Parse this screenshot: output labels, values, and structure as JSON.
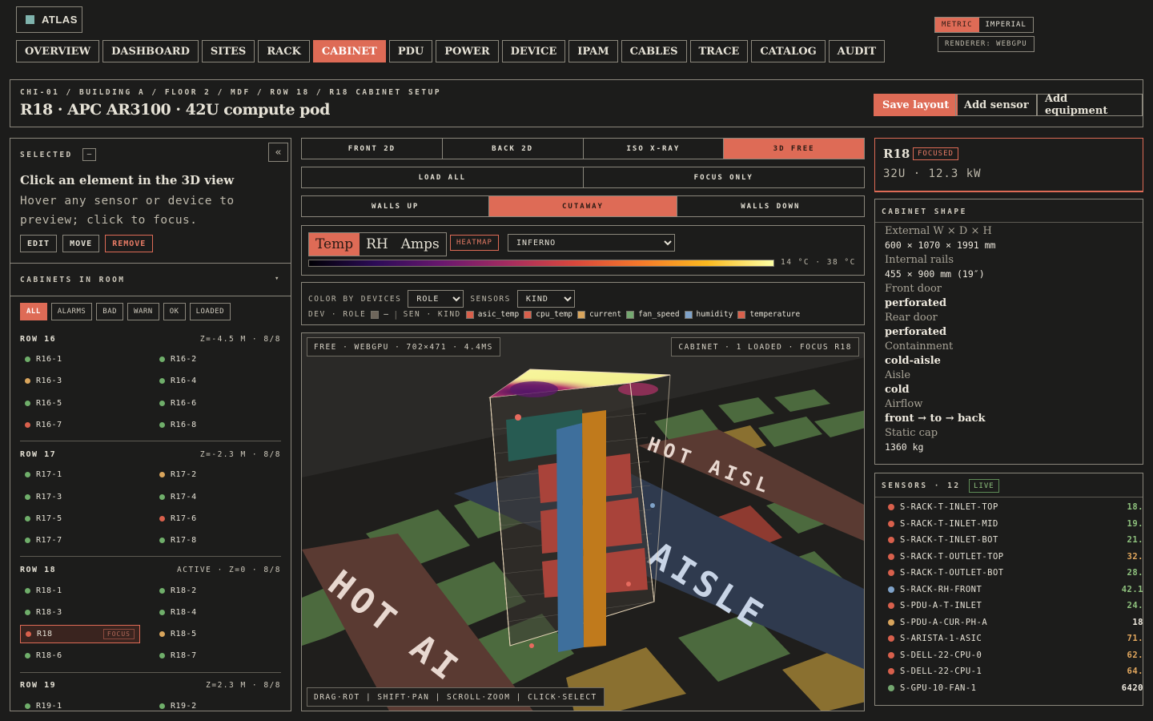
{
  "app": {
    "name": "ATLAS",
    "logo_color": "#7fb3ad"
  },
  "nav": [
    {
      "label": "OVERVIEW",
      "active": false
    },
    {
      "label": "DASHBOARD",
      "active": false
    },
    {
      "label": "SITES",
      "active": false
    },
    {
      "label": "RACK",
      "active": false
    },
    {
      "label": "CABINET",
      "active": true
    },
    {
      "label": "PDU",
      "active": false
    },
    {
      "label": "POWER",
      "active": false
    },
    {
      "label": "DEVICE",
      "active": false
    },
    {
      "label": "IPAM",
      "active": false
    },
    {
      "label": "CABLES",
      "active": false
    },
    {
      "label": "TRACE",
      "active": false
    },
    {
      "label": "CATALOG",
      "active": false
    },
    {
      "label": "AUDIT",
      "active": false
    }
  ],
  "units": {
    "metric": "METRIC",
    "imperial": "IMPERIAL",
    "selected": "METRIC"
  },
  "renderer": "RENDERER: WEBGPU",
  "header": {
    "breadcrumb": "CHI-01 / BUILDING A / FLOOR 2 / MDF / ROW 18 / R18 CABINET SETUP",
    "title": "R18 · APC AR3100 · 42U compute pod",
    "save": "Save layout",
    "add_sensor": "Add sensor",
    "add_equipment": "Add equipment"
  },
  "selected": {
    "label": "SELECTED",
    "badge": "—",
    "collapse": "«",
    "heading": "Click an element in the 3D view",
    "hint": "Hover any sensor or device to preview; click to focus.",
    "edit": "EDIT",
    "move": "MOVE",
    "remove": "REMOVE"
  },
  "cabinets": {
    "label": "CABINETS IN ROOM",
    "chevron": "▾",
    "filters": [
      "ALL",
      "ALARMS",
      "BAD",
      "WARN",
      "OK",
      "LOADED"
    ],
    "active_filter": "ALL",
    "rows": [
      {
        "name": "ROW 16",
        "meta": "Z=-4.5 M · 8/8",
        "items": [
          {
            "id": "R16-1",
            "status": "ok"
          },
          {
            "id": "R16-2",
            "status": "ok"
          },
          {
            "id": "R16-3",
            "status": "warn"
          },
          {
            "id": "R16-4",
            "status": "ok"
          },
          {
            "id": "R16-5",
            "status": "ok"
          },
          {
            "id": "R16-6",
            "status": "ok"
          },
          {
            "id": "R16-7",
            "status": "bad"
          },
          {
            "id": "R16-8",
            "status": "ok"
          }
        ]
      },
      {
        "name": "ROW 17",
        "meta": "Z=-2.3 M · 8/8",
        "items": [
          {
            "id": "R17-1",
            "status": "ok"
          },
          {
            "id": "R17-2",
            "status": "warn"
          },
          {
            "id": "R17-3",
            "status": "ok"
          },
          {
            "id": "R17-4",
            "status": "ok"
          },
          {
            "id": "R17-5",
            "status": "ok"
          },
          {
            "id": "R17-6",
            "status": "bad"
          },
          {
            "id": "R17-7",
            "status": "ok"
          },
          {
            "id": "R17-8",
            "status": "ok"
          }
        ]
      },
      {
        "name": "ROW 18",
        "meta": "ACTIVE · Z=0 · 8/8",
        "items": [
          {
            "id": "R18-1",
            "status": "ok"
          },
          {
            "id": "R18-2",
            "status": "ok"
          },
          {
            "id": "R18-3",
            "status": "ok"
          },
          {
            "id": "R18-4",
            "status": "ok"
          },
          {
            "id": "R18",
            "status": "bad",
            "focus": "FOCUS"
          },
          {
            "id": "R18-5",
            "status": "warn"
          },
          {
            "id": "R18-6",
            "status": "ok"
          },
          {
            "id": "R18-7",
            "status": "ok"
          }
        ]
      },
      {
        "name": "ROW 19",
        "meta": "Z=2.3 M · 8/8",
        "items": [
          {
            "id": "R19-1",
            "status": "ok"
          },
          {
            "id": "R19-2",
            "status": "ok"
          }
        ]
      }
    ]
  },
  "views": {
    "options": [
      "FRONT 2D",
      "BACK 2D",
      "ISO X-RAY",
      "3D FREE"
    ],
    "active": "3D FREE"
  },
  "load": {
    "options": [
      "LOAD ALL",
      "FOCUS ONLY"
    ]
  },
  "walls": {
    "options": [
      "WALLS UP",
      "CUTAWAY",
      "WALLS DOWN"
    ],
    "active": "CUTAWAY"
  },
  "metric": {
    "options": [
      "Temp",
      "RH",
      "Amps"
    ],
    "active": "Temp",
    "heatmap": "HEATMAP",
    "palette": "INFERNO",
    "range": "14 °C · 38 °C"
  },
  "colorby": {
    "label": "COLOR BY",
    "devices": "DEVICES",
    "role": "ROLE",
    "sensors": "SENSORS",
    "kind": "KIND",
    "dev_label": "DEV · ROLE",
    "dev_dash": "—",
    "sen_label": "SEN · KIND",
    "kinds": [
      {
        "name": "asic_temp",
        "color": "#d8604c"
      },
      {
        "name": "cpu_temp",
        "color": "#d8604c"
      },
      {
        "name": "current",
        "color": "#d9a55c"
      },
      {
        "name": "fan_speed",
        "color": "#74a870"
      },
      {
        "name": "humidity",
        "color": "#7fa2c8"
      },
      {
        "name": "temperature",
        "color": "#d8604c"
      }
    ]
  },
  "viewport": {
    "status": "FREE · WEBGPU · 702×471 · 4.4MS",
    "scope": "CABINET · 1 LOADED · FOCUS R18",
    "controls": "DRAG·ROT | SHIFT·PAN | SCROLL·ZOOM | CLICK·SELECT",
    "hot_aisle": "HOT AISLE",
    "cold_aisle": "COLD AISLE"
  },
  "focus": {
    "id": "R18",
    "badge": "FOCUSED",
    "summary": "32U · 12.3 kW"
  },
  "shape": {
    "label": "CABINET SHAPE",
    "rows": [
      {
        "k": "External W × D × H",
        "v": "600 × 1070 × 1991 mm",
        "mono": true
      },
      {
        "k": "Internal rails",
        "v": "455 × 900 mm (19″)",
        "mono": true
      },
      {
        "k": "Front door",
        "v": "perforated",
        "mono": false
      },
      {
        "k": "Rear door",
        "v": "perforated",
        "mono": false
      },
      {
        "k": "Containment",
        "v": "cold-aisle",
        "mono": false
      },
      {
        "k": "Aisle",
        "v": "cold",
        "mono": false
      },
      {
        "k": "Airflow",
        "v": "front → to → back",
        "mono": false
      },
      {
        "k": "Static cap",
        "v": "1360 kg",
        "mono": true
      }
    ]
  },
  "sensors": {
    "label": "SENSORS · 12",
    "live": "LIVE",
    "items": [
      {
        "name": "S-RACK-T-INLET-TOP",
        "value": "18.",
        "color": "#d8604c",
        "vcolor": "#8fc27e"
      },
      {
        "name": "S-RACK-T-INLET-MID",
        "value": "19.",
        "color": "#d8604c",
        "vcolor": "#8fc27e"
      },
      {
        "name": "S-RACK-T-INLET-BOT",
        "value": "21.",
        "color": "#d8604c",
        "vcolor": "#8fc27e"
      },
      {
        "name": "S-RACK-T-OUTLET-TOP",
        "value": "32.",
        "color": "#d8604c",
        "vcolor": "#e3a85e"
      },
      {
        "name": "S-RACK-T-OUTLET-BOT",
        "value": "28.",
        "color": "#d8604c",
        "vcolor": "#8fc27e"
      },
      {
        "name": "S-RACK-RH-FRONT",
        "value": "42.1",
        "color": "#7fa2c8",
        "vcolor": "#8fc27e"
      },
      {
        "name": "S-PDU-A-T-INLET",
        "value": "24.",
        "color": "#d8604c",
        "vcolor": "#8fc27e"
      },
      {
        "name": "S-PDU-A-CUR-PH-A",
        "value": "18",
        "color": "#d9a55c",
        "vcolor": "#efeadf"
      },
      {
        "name": "S-ARISTA-1-ASIC",
        "value": "71.",
        "color": "#d8604c",
        "vcolor": "#e3a85e"
      },
      {
        "name": "S-DELL-22-CPU-0",
        "value": "62.",
        "color": "#d8604c",
        "vcolor": "#e3a85e"
      },
      {
        "name": "S-DELL-22-CPU-1",
        "value": "64.",
        "color": "#d8604c",
        "vcolor": "#e3a85e"
      },
      {
        "name": "S-GPU-10-FAN-1",
        "value": "6420",
        "color": "#74a870",
        "vcolor": "#efeadf"
      }
    ]
  },
  "status_colors": {
    "ok": "#6fae6a",
    "warn": "#d9a55c",
    "bad": "#d8604c"
  }
}
